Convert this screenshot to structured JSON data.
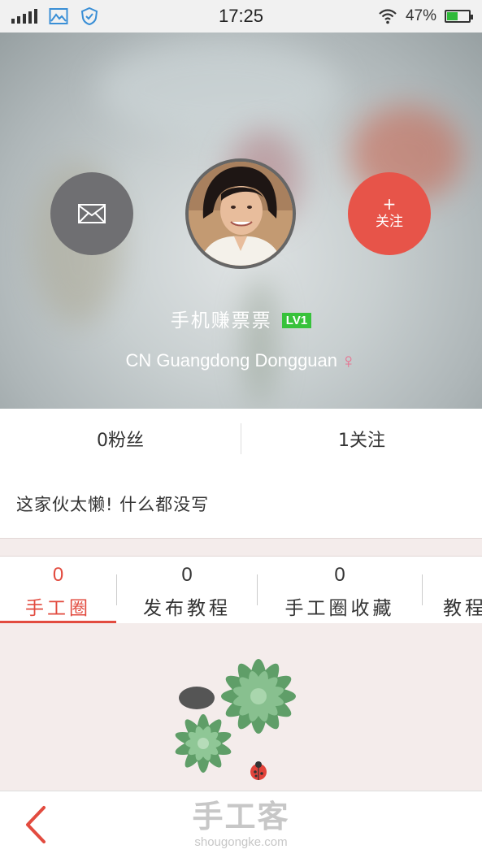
{
  "status_bar": {
    "time": "17:25",
    "battery": "47%",
    "battery_level": 0.47
  },
  "profile": {
    "nickname": "手机赚票票",
    "level": "LV1",
    "location": "CN  Guangdong  Dongguan",
    "gender_symbol": "♀",
    "follow_label": "关注",
    "follow_plus": "+"
  },
  "stats": {
    "fans": "0粉丝",
    "following": "1关注"
  },
  "bio": "这家伙太懒! 什么都没写",
  "tabs": [
    {
      "count": "0",
      "label": "手工圈"
    },
    {
      "count": "0",
      "label": "发布教程"
    },
    {
      "count": "0",
      "label": "手工圈收藏"
    },
    {
      "count": "",
      "label": "教程"
    }
  ],
  "footer": {
    "brand_cn": "手工客",
    "brand_en": "shougongke.com"
  },
  "colors": {
    "accent": "#e24b3f",
    "level_badge": "#37c23b",
    "gender": "#e96d8c"
  },
  "icons": [
    "signal-icon",
    "image-icon",
    "shield-icon",
    "wifi-icon",
    "battery-icon",
    "mail-icon",
    "back-arrow-icon"
  ]
}
